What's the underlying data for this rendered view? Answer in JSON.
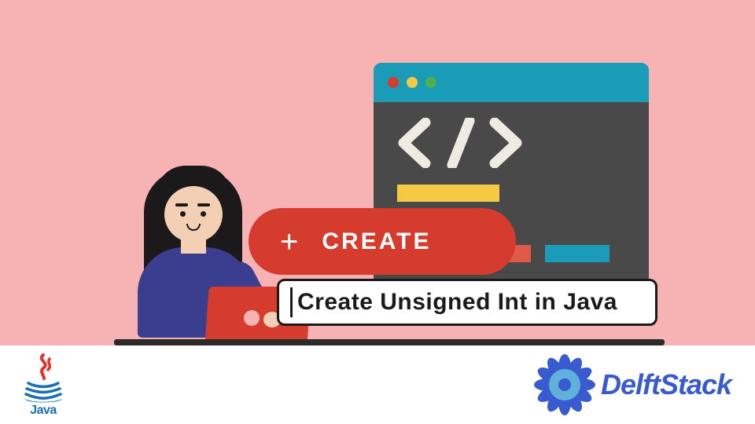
{
  "stage": {
    "create_label": "CREATE",
    "plus": "+",
    "title": "Create Unsigned Int in Java",
    "code_icon_glyphs": "</>"
  },
  "logos": {
    "java_word": "Java",
    "delft_word": "DelftStack"
  },
  "icons": {
    "traffic_red": "traffic-light-red",
    "traffic_yellow": "traffic-light-yellow",
    "traffic_green": "traffic-light-green"
  }
}
